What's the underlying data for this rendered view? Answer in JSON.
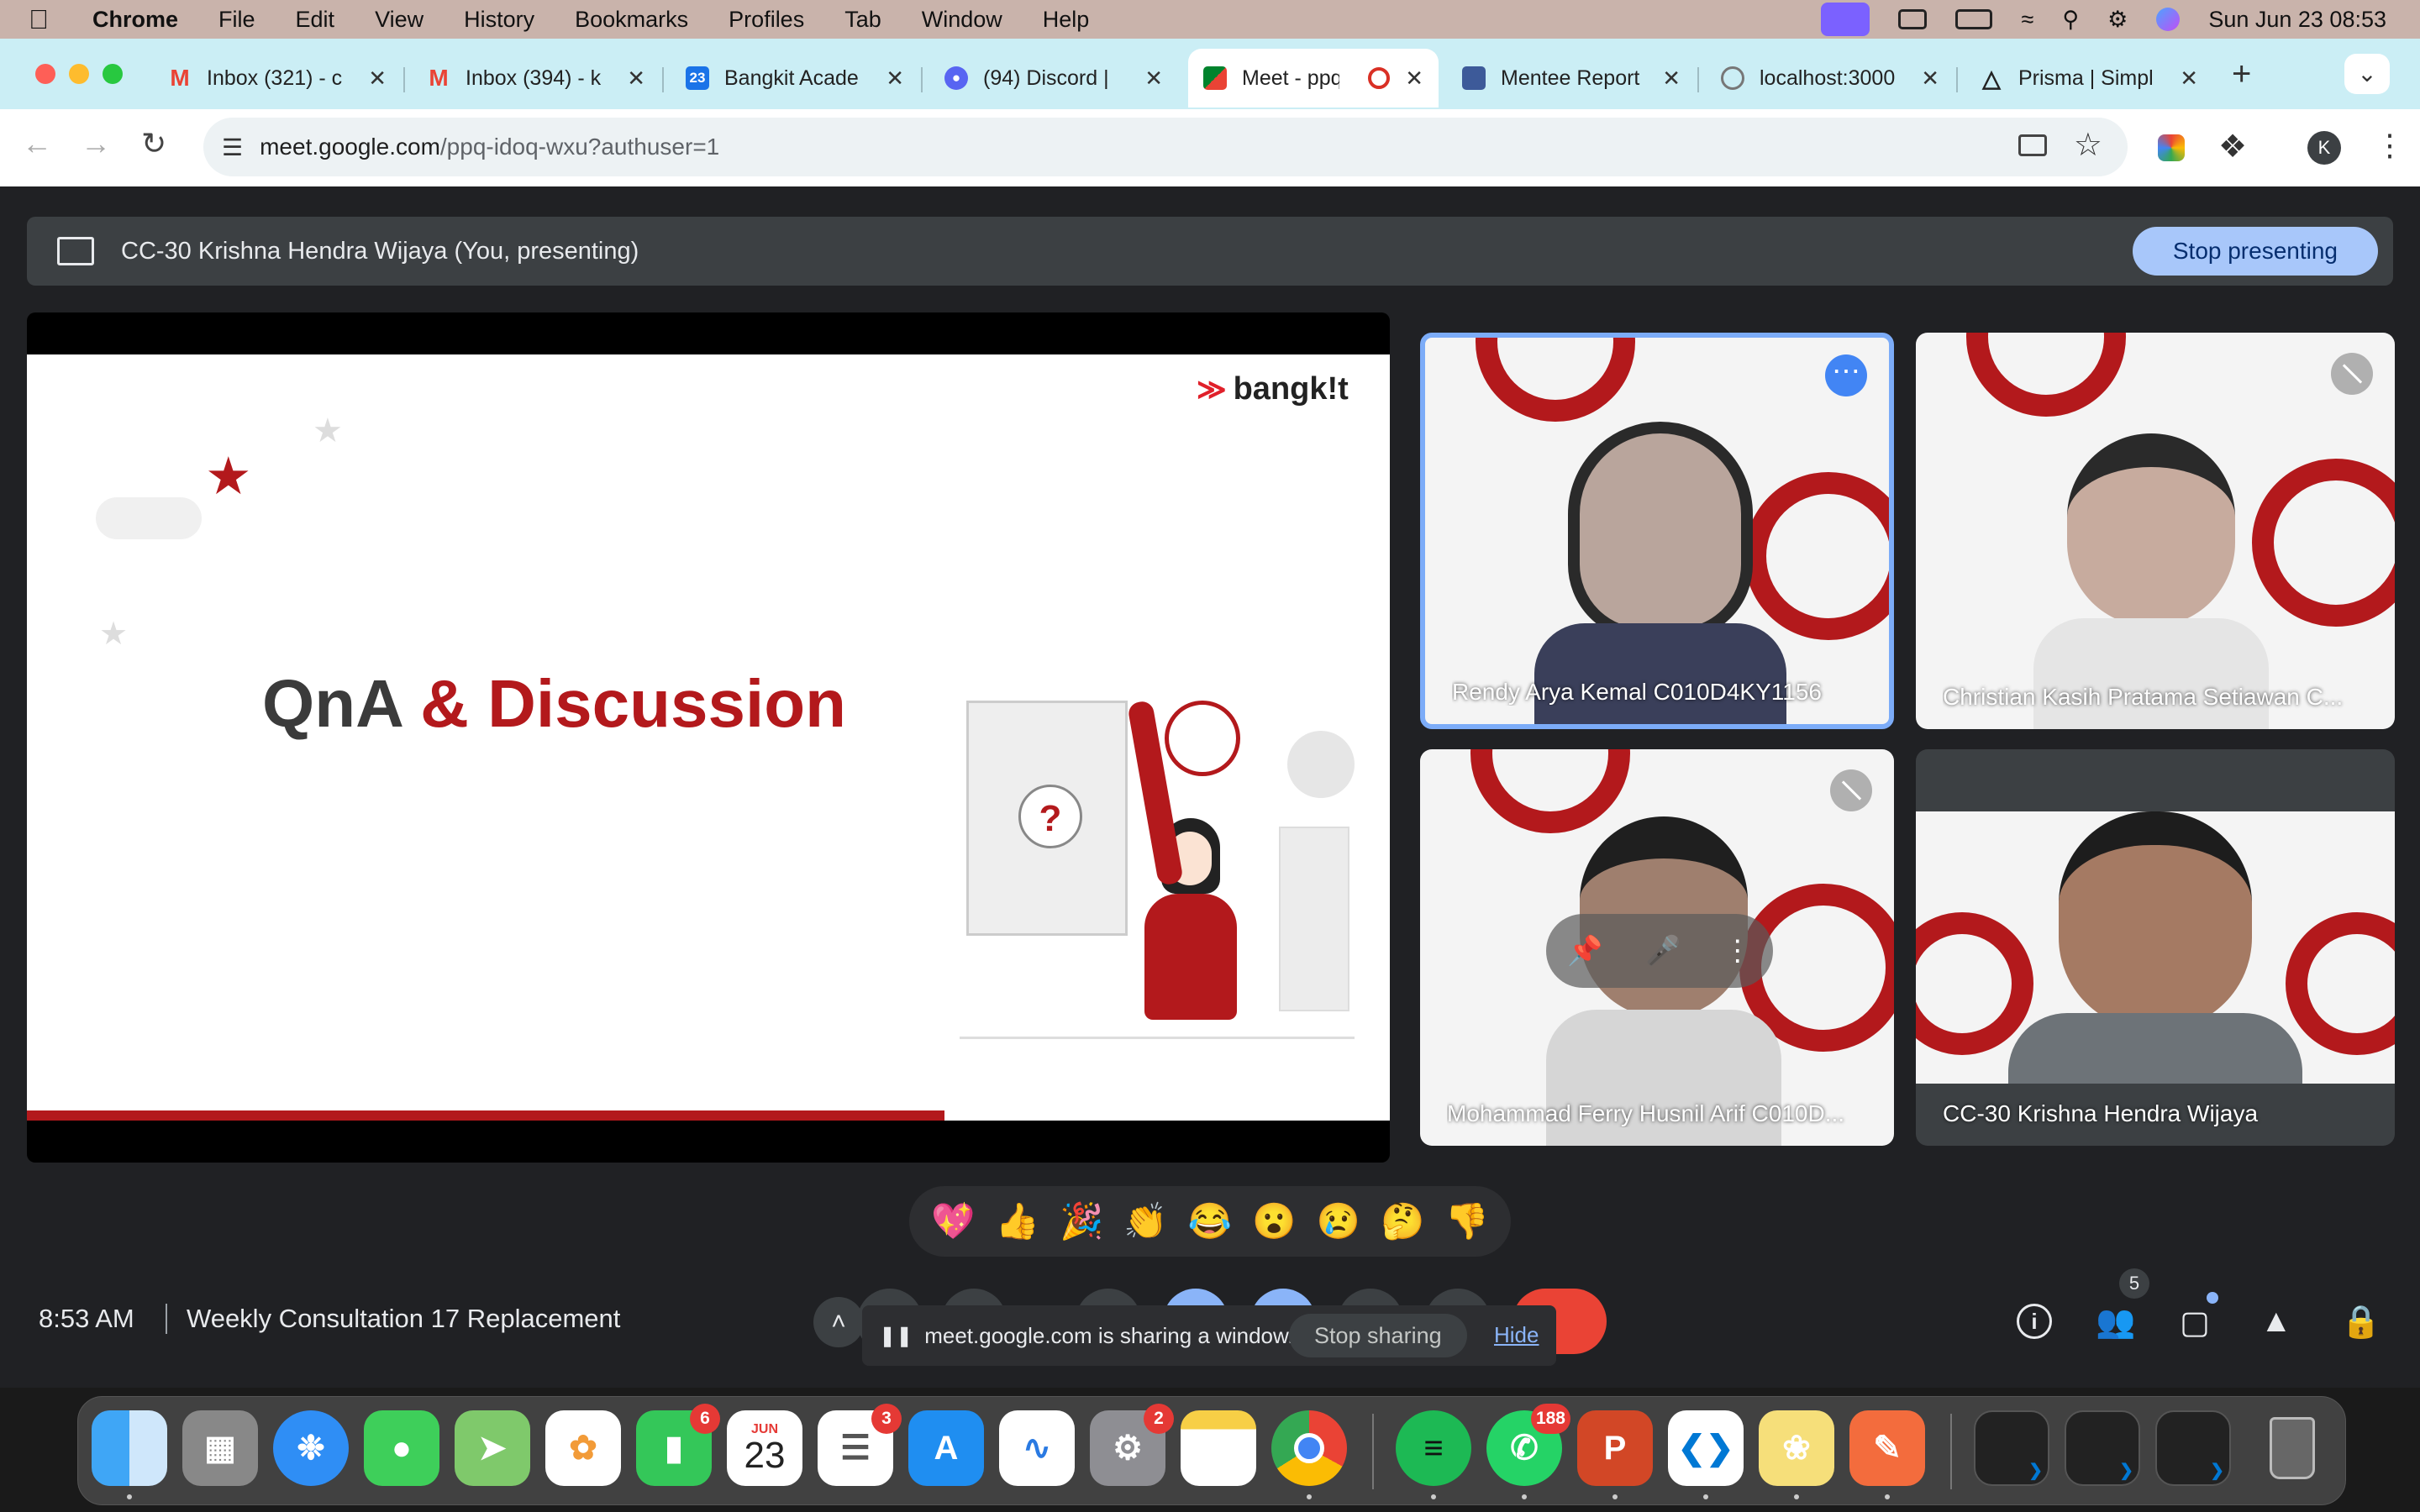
{
  "menubar": {
    "app_name": "Chrome",
    "menus": [
      "File",
      "Edit",
      "View",
      "History",
      "Bookmarks",
      "Profiles",
      "Tab",
      "Window",
      "Help"
    ],
    "datetime": "Sun Jun 23  08:53"
  },
  "tabs": [
    {
      "title": "Inbox (321) - c",
      "icon": "gmail-icon"
    },
    {
      "title": "Inbox (394) - k",
      "icon": "gmail-icon"
    },
    {
      "title": "Bangkit Acade",
      "icon": "calendar-icon"
    },
    {
      "title": "(94) Discord |",
      "icon": "discord-icon"
    },
    {
      "title": "Meet - ppq",
      "icon": "meet-icon",
      "active": true
    },
    {
      "title": "Mentee Report",
      "icon": "report-icon"
    },
    {
      "title": "localhost:3000",
      "icon": "globe-icon"
    },
    {
      "title": "Prisma | Simpl",
      "icon": "prisma-icon"
    }
  ],
  "url": {
    "host": "meet.google.com",
    "path": "/ppq-idoq-wxu?authuser=1"
  },
  "profile_initial": "K",
  "presenting": {
    "label": "CC-30 Krishna Hendra Wijaya (You, presenting)",
    "stop_label": "Stop presenting"
  },
  "slide": {
    "brand": "bangk!t",
    "title_part1": "QnA",
    "title_part2": "& Discussion",
    "question_mark": "?"
  },
  "participants": [
    {
      "name": "Rendy Arya Kemal C010D4KY1156",
      "active_speaker": true
    },
    {
      "name": "Christian Kasih Pratama Setiawan C...",
      "muted": true
    },
    {
      "name": "Mohammad Ferry Husnil Arif C010D...",
      "muted": true
    },
    {
      "name": "CC-30 Krishna Hendra Wijaya"
    }
  ],
  "reactions": [
    "💖",
    "👍",
    "🎉",
    "👏",
    "😂",
    "😮",
    "😢",
    "🤔",
    "👎"
  ],
  "meeting": {
    "time": "8:53 AM",
    "title": "Weekly Consultation 17 Replacement",
    "people_count": "5"
  },
  "sharing_banner": {
    "text": "meet.google.com is sharing a window.",
    "stop_label": "Stop sharing",
    "hide_label": "Hide"
  },
  "dock": {
    "facetime_badge": "6",
    "calendar_month": "JUN",
    "calendar_day": "23",
    "reminders_badge": "3",
    "settings_badge": "2",
    "whatsapp_badge": "188"
  },
  "colors": {
    "menubar": "#c9b3ab",
    "tabstrip": "#cbeef5",
    "meet_bg": "#202124",
    "accent_blue": "#a8c7fa",
    "brand_red": "#b3191c"
  }
}
